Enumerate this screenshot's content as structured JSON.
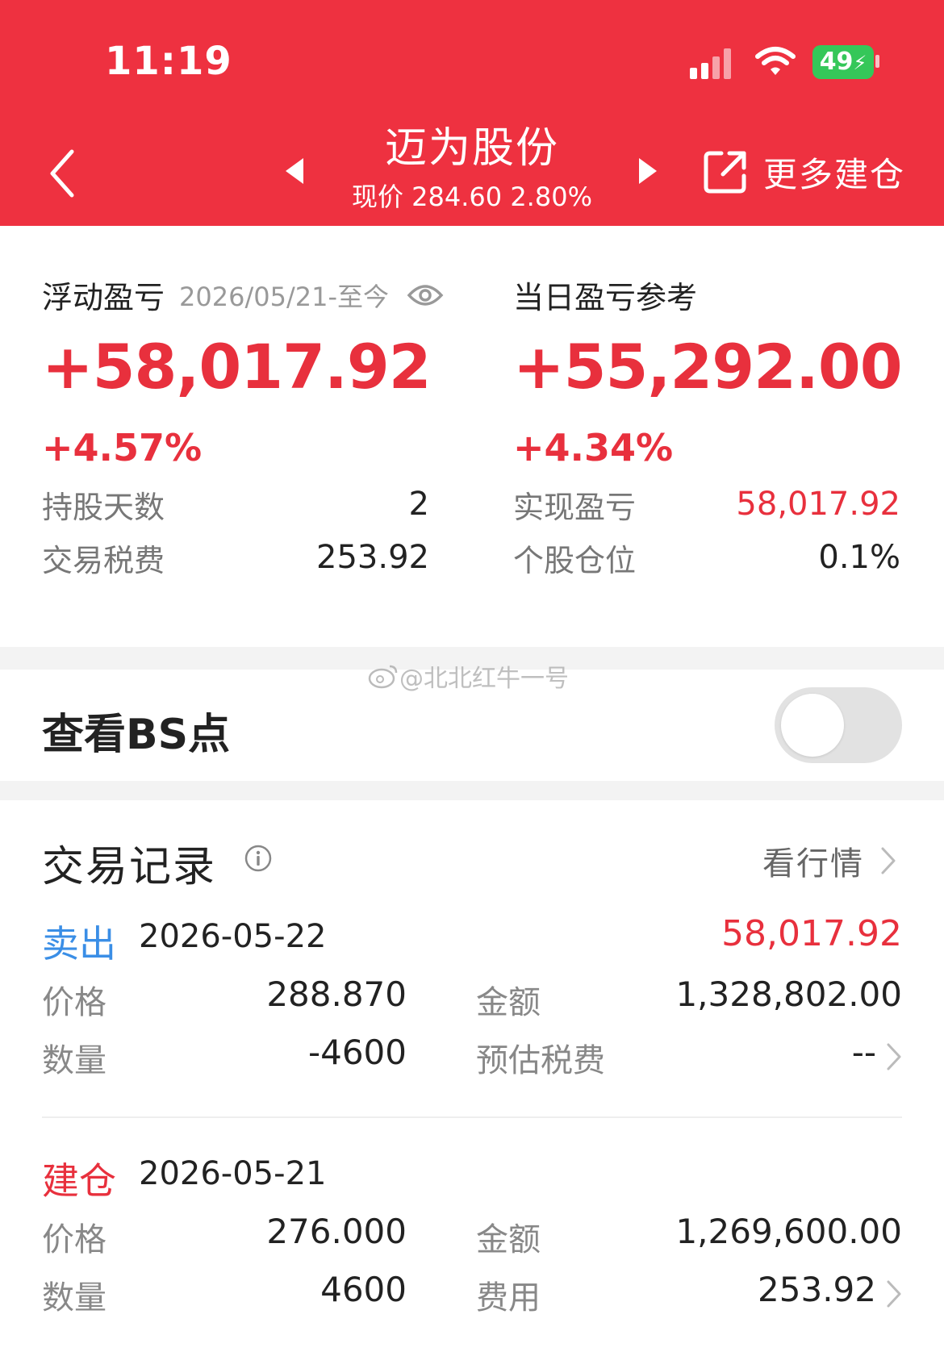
{
  "status_bar": {
    "time": "11:19",
    "battery": "49"
  },
  "header": {
    "stock_name": "迈为股份",
    "price_line": "现价 284.60 2.80%",
    "more_label": "更多建仓",
    "bg_color": "#ee3140"
  },
  "floating": {
    "label": "浮动盈亏",
    "date_range": "2026/05/21-至今",
    "value": "+58,017.92",
    "pct": "+4.57%"
  },
  "daily": {
    "label": "当日盈亏参考",
    "value": "+55,292.00",
    "pct": "+4.34%"
  },
  "stats_left": [
    {
      "label": "持股天数",
      "value": "2"
    },
    {
      "label": "交易税费",
      "value": "253.92"
    }
  ],
  "stats_right": [
    {
      "label": "实现盈亏",
      "value": "58,017.92"
    },
    {
      "label": "个股仓位",
      "value": "0.1%"
    }
  ],
  "watermark": "@北北红牛一号",
  "bs": {
    "label": "查看BS点",
    "enabled": false
  },
  "records": {
    "title": "交易记录",
    "view_market": "看行情",
    "trades": [
      {
        "type": "卖出",
        "date": "2026-05-22",
        "profit": "58,017.92",
        "price_label": "价格",
        "price": "288.870",
        "amount_label": "金额",
        "amount": "1,328,802.00",
        "qty_label": "数量",
        "qty": "-4600",
        "fee_label": "预估税费",
        "fee": "--"
      },
      {
        "type": "建仓",
        "date": "2026-05-21",
        "price_label": "价格",
        "price": "276.000",
        "amount_label": "金额",
        "amount": "1,269,600.00",
        "qty_label": "数量",
        "qty": "4600",
        "fee_label": "费用",
        "fee": "253.92"
      }
    ]
  },
  "colors": {
    "up_red": "#e8303d",
    "sell_blue": "#3a8ee6",
    "battery_green": "#35c759"
  }
}
